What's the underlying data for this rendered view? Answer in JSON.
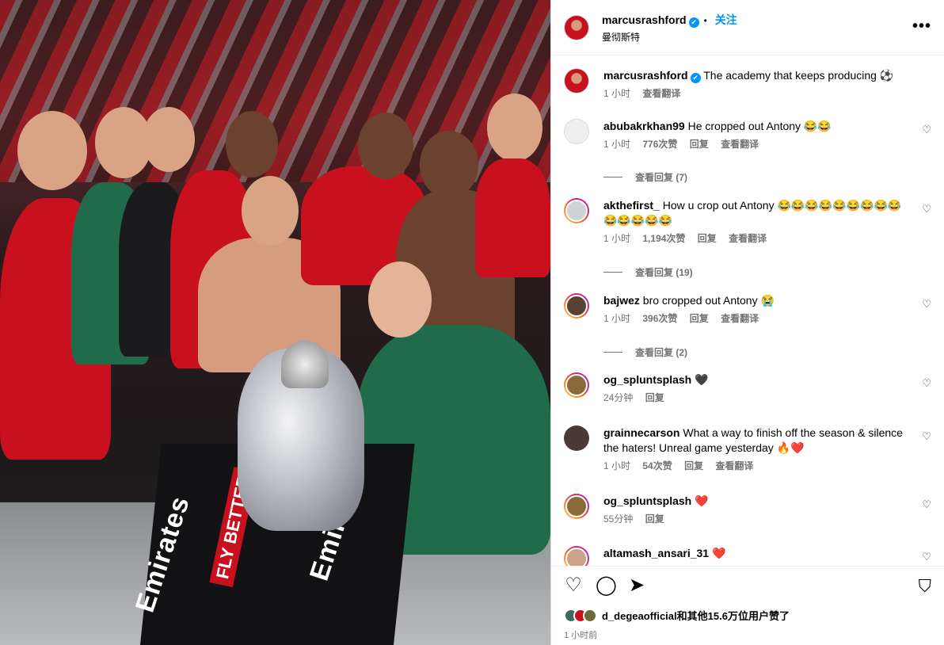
{
  "post": {
    "username": "marcusrashford",
    "verified_badge": "✔",
    "follow_label": "关注",
    "location": "曼彻斯特",
    "more_label": "•••",
    "caption": "The academy that keeps producing ⚽",
    "caption_time": "1 小时",
    "caption_translate": "查看翻译"
  },
  "photo": {
    "banner_line1": "Emirates",
    "banner_line2": "FLY BETTER",
    "banner_line3": "Emirates"
  },
  "comments": [
    {
      "user": "abubakrkhan99",
      "text": "He cropped out Antony 😂😂",
      "time": "1 小时",
      "likes": "776次赞",
      "reply": "回复",
      "translate": "查看翻译",
      "view_replies": "查看回复 (7)"
    },
    {
      "user": "akthefirst_",
      "text": "How u crop out Antony 😂😂😂😂😂😂😂😂😂😂😂😂😂😂",
      "time": "1 小时",
      "likes": "1,194次赞",
      "reply": "回复",
      "translate": "查看翻译",
      "view_replies": "查看回复 (19)"
    },
    {
      "user": "bajwez",
      "text": "bro cropped out Antony 😭",
      "time": "1 小时",
      "likes": "396次赞",
      "reply": "回复",
      "translate": "查看翻译",
      "view_replies": "查看回复 (2)"
    },
    {
      "user": "og_spluntsplash",
      "text": "🖤",
      "time": "24分钟",
      "reply": "回复"
    },
    {
      "user": "grainnecarson",
      "text": "What a way to finish off the season & silence the haters! Unreal game yesterday 🔥❤️",
      "time": "1 小时",
      "likes": "54次赞",
      "reply": "回复",
      "translate": "查看翻译"
    },
    {
      "user": "og_spluntsplash",
      "text": "❤️",
      "time": "55分钟",
      "reply": "回复"
    },
    {
      "user": "altamash_ansari_31",
      "text": "❤️"
    }
  ],
  "icons": {
    "heart": "♡",
    "comment": "◯",
    "share": "➤",
    "bookmark": "⛉"
  },
  "footer": {
    "likes_user": "d_degeaofficial",
    "likes_text": "和其他15.6万位用户赞了",
    "time": "1 小时前"
  }
}
